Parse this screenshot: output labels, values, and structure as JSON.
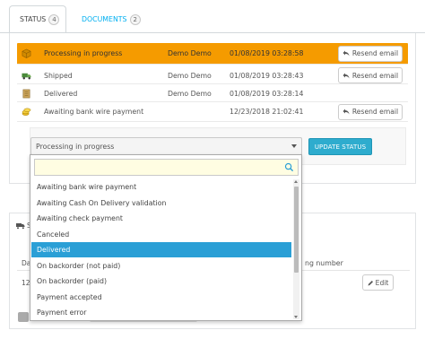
{
  "tabs": [
    {
      "label": "STATUS",
      "count": "4",
      "icon": "clock-icon"
    },
    {
      "label": "DOCUMENTS",
      "count": "2",
      "icon": "file-icon"
    }
  ],
  "history": {
    "rows": [
      {
        "status": "Processing in progress",
        "employee": "Demo Demo",
        "date": "01/08/2019 03:28:58",
        "action": "Resend email",
        "icon": "package-icon",
        "highlight": "#f59b00"
      },
      {
        "status": "Shipped",
        "employee": "Demo Demo",
        "date": "01/08/2019 03:28:43",
        "action": "Resend email",
        "icon": "truck-icon"
      },
      {
        "status": "Delivered",
        "employee": "Demo Demo",
        "date": "01/08/2019 03:28:14",
        "action": "",
        "icon": "box-icon"
      },
      {
        "status": "Awaiting bank wire payment",
        "employee": "",
        "date": "12/23/2018 21:02:41",
        "action": "Resend email",
        "icon": "coins-icon"
      }
    ]
  },
  "update_form": {
    "selected_status": "Processing in progress",
    "button_label": "UPDATE STATUS",
    "button_color": "#2eacce"
  },
  "dropdown": {
    "search_value": "",
    "options": [
      "Awaiting bank wire payment",
      "Awaiting Cash On Delivery validation",
      "Awaiting check payment",
      "Canceled",
      "Delivered",
      "On backorder (not paid)",
      "On backorder (paid)",
      "Payment accepted",
      "Payment error"
    ],
    "highlighted": "Delivered",
    "highlight_color": "#2a9fd6"
  },
  "lower_panel": {
    "header_fragment": "SI",
    "column_fragment": "Da",
    "cell_fragment": "12",
    "tracking_label": "ng number",
    "edit_label": "Edit"
  }
}
